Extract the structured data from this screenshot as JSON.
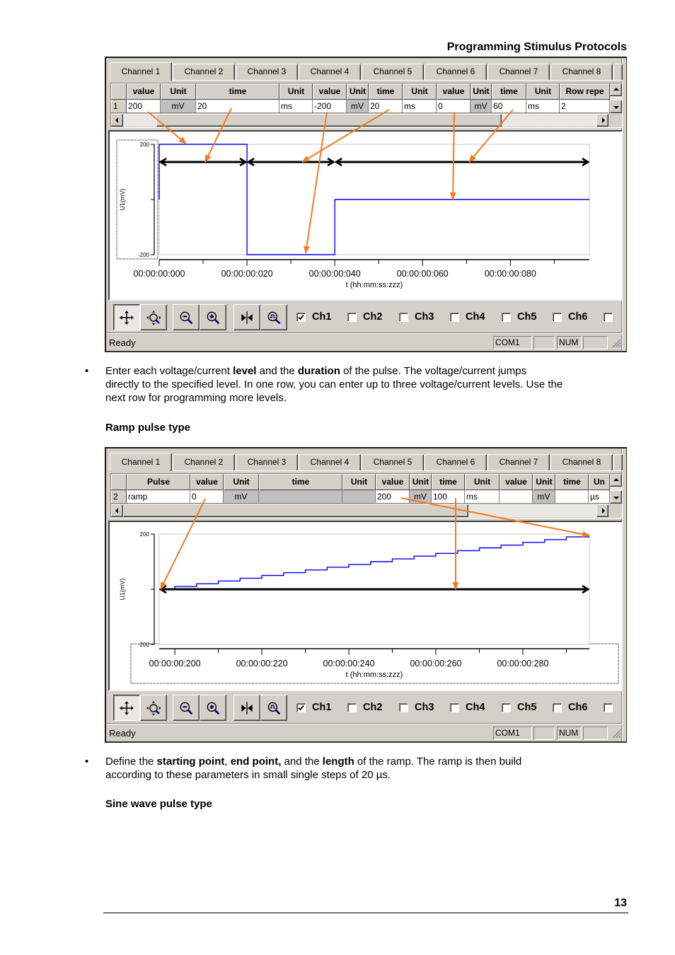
{
  "page": {
    "header_title": "Programming Stimulus Protocols",
    "page_number": "13",
    "bullet_glyph": "•"
  },
  "bullet1": {
    "line1": [
      "Enter each voltage/current ",
      "level",
      " and the ",
      "duration",
      " of the pulse. The voltage/current jumps"
    ],
    "line2": "directly to the specified level. In one row, you can enter up to three voltage/current levels. Use the",
    "line3": "next row for programming more levels."
  },
  "heading_ramp": "Ramp pulse type",
  "bullet2": {
    "line1": [
      "Define the ",
      "starting point",
      ", ",
      "end point,",
      " and the ",
      "length",
      " of the ramp. The ramp is then build"
    ],
    "line2": "according to these parameters in small single steps of 20 µs."
  },
  "heading_sine": "Sine wave pulse type",
  "colors": {
    "annotation": "#f47b20",
    "trace": "#0000ff",
    "window_bg": "#d4d0c8"
  },
  "windows": [
    {
      "tabs": [
        "Channel 1",
        "Channel 2",
        "Channel 3",
        "Channel 4",
        "Channel 5",
        "Channel 6",
        "Channel 7",
        "Channel 8"
      ],
      "active_tab": "Channel 1",
      "grid": {
        "columns": [
          "value",
          "Unit",
          "time",
          "Unit",
          "value",
          "Unit",
          "time",
          "Unit",
          "value",
          "Unit",
          "time",
          "Unit",
          "Row repe"
        ],
        "row": {
          "index": "1",
          "cells": [
            {
              "text": "200",
              "readonly": false
            },
            {
              "text": "mV",
              "readonly": true
            },
            {
              "text": "20",
              "readonly": false
            },
            {
              "text": "ms",
              "readonly": false
            },
            {
              "text": "-200",
              "readonly": false
            },
            {
              "text": "mV",
              "readonly": true
            },
            {
              "text": "20",
              "readonly": false
            },
            {
              "text": "ms",
              "readonly": false
            },
            {
              "text": "0",
              "readonly": false
            },
            {
              "text": "mV",
              "readonly": true
            },
            {
              "text": "60",
              "readonly": false
            },
            {
              "text": "ms",
              "readonly": false
            },
            {
              "text": "2",
              "readonly": false
            }
          ]
        },
        "h_scroll": {
          "position": 0.07,
          "visible_fraction": 0.73
        }
      },
      "toolbar": {
        "buttons": [
          {
            "id": "pan",
            "icon": "pan-icon",
            "pressed": true
          },
          {
            "id": "zoom-fit",
            "icon": "zoom-fit-icon",
            "pressed": false
          },
          {
            "id": "zoom-out",
            "icon": "zoom-out-icon",
            "pressed": false
          },
          {
            "id": "zoom-in",
            "icon": "zoom-in-icon",
            "pressed": false
          },
          {
            "id": "marker",
            "icon": "marker-icon",
            "pressed": false
          },
          {
            "id": "signal-zoom",
            "icon": "signal-zoom-icon",
            "pressed": false
          }
        ],
        "channels": [
          {
            "label": "Ch1",
            "checked": true
          },
          {
            "label": "Ch2",
            "checked": false
          },
          {
            "label": "Ch3",
            "checked": false
          },
          {
            "label": "Ch4",
            "checked": false
          },
          {
            "label": "Ch5",
            "checked": false
          },
          {
            "label": "Ch6",
            "checked": false
          },
          {
            "label": "",
            "checked": false
          }
        ]
      },
      "status": {
        "text": "Ready",
        "panels": [
          "COM1",
          "",
          "NUM",
          ""
        ]
      }
    },
    {
      "tabs": [
        "Channel 1",
        "Channel 2",
        "Channel 3",
        "Channel 4",
        "Channel 5",
        "Channel 6",
        "Channel 7",
        "Channel 8"
      ],
      "active_tab": "Channel 1",
      "grid": {
        "columns": [
          "Pulse",
          "value",
          "Unit",
          "time",
          "Unit",
          "value",
          "Unit",
          "time",
          "Unit",
          "value",
          "Unit",
          "time",
          "Un"
        ],
        "row": {
          "index": "2",
          "cells": [
            {
              "text": "ramp",
              "readonly": false
            },
            {
              "text": "0",
              "readonly": false
            },
            {
              "text": "mV",
              "readonly": true
            },
            {
              "text": "",
              "readonly": true
            },
            {
              "text": "",
              "readonly": true
            },
            {
              "text": "200",
              "readonly": false
            },
            {
              "text": "mV",
              "readonly": true
            },
            {
              "text": "100",
              "readonly": false
            },
            {
              "text": "ms",
              "readonly": false
            },
            {
              "text": "",
              "readonly": false
            },
            {
              "text": "mV",
              "readonly": true
            },
            {
              "text": "",
              "readonly": false
            },
            {
              "text": "µs",
              "readonly": false
            }
          ]
        },
        "h_scroll": {
          "position": 0.0,
          "visible_fraction": 0.73
        }
      },
      "toolbar": {
        "buttons": [
          {
            "id": "pan",
            "icon": "pan-icon",
            "pressed": true
          },
          {
            "id": "zoom-fit",
            "icon": "zoom-fit-icon",
            "pressed": false
          },
          {
            "id": "zoom-out",
            "icon": "zoom-out-icon",
            "pressed": false
          },
          {
            "id": "zoom-in",
            "icon": "zoom-in-icon",
            "pressed": false
          },
          {
            "id": "marker",
            "icon": "marker-icon",
            "pressed": false
          },
          {
            "id": "signal-zoom",
            "icon": "signal-zoom-icon",
            "pressed": false
          }
        ],
        "channels": [
          {
            "label": "Ch1",
            "checked": true
          },
          {
            "label": "Ch2",
            "checked": false
          },
          {
            "label": "Ch3",
            "checked": false
          },
          {
            "label": "Ch4",
            "checked": false
          },
          {
            "label": "Ch5",
            "checked": false
          },
          {
            "label": "Ch6",
            "checked": false
          },
          {
            "label": "",
            "checked": false
          }
        ]
      },
      "status": {
        "text": "Ready",
        "panels": [
          "COM1",
          "",
          "NUM",
          ""
        ]
      }
    }
  ],
  "chart_data": [
    {
      "type": "line",
      "title": "",
      "xlabel": "t (hh:mm:ss:zzz)",
      "ylabel": "U1(mV)",
      "xlim": [
        0,
        98
      ],
      "ylim": [
        -200,
        200
      ],
      "x_ticks": [
        0,
        20,
        40,
        60,
        80
      ],
      "x_tick_labels": [
        "00:00:00:000",
        "00:00:00:020",
        "00:00:00:040",
        "00:00:00:060",
        "00:00:00:080"
      ],
      "x_minor_ticks": [
        10,
        30,
        50,
        70,
        90
      ],
      "y_ticks": [
        200,
        0,
        -200
      ],
      "y_tick_labels": [
        "200",
        "",
        "-200"
      ],
      "grid": false,
      "legend": "none",
      "series": [
        {
          "name": "Ch1",
          "color": "#0000ff",
          "step": "post",
          "x": [
            0,
            0,
            20,
            40
          ],
          "y": [
            0,
            200,
            -200,
            0
          ]
        }
      ],
      "annotations": {
        "duration_markers": [
          [
            0,
            20
          ],
          [
            20,
            40
          ],
          [
            40,
            98
          ]
        ]
      }
    },
    {
      "type": "line",
      "title": "",
      "xlabel": "t (hh:mm:ss:zzz)",
      "ylabel": "U1(mV)",
      "xlim": [
        196.4,
        295.3
      ],
      "ylim": [
        -200,
        200
      ],
      "x_ticks": [
        200,
        220,
        240,
        260,
        280
      ],
      "x_tick_labels": [
        "00:00:00:200",
        "00:00:00:220",
        "00:00:00:240",
        "00:00:00:260",
        "00:00:00:280"
      ],
      "x_minor_ticks": [
        210,
        230,
        250,
        270,
        290
      ],
      "y_ticks": [
        200,
        0,
        -200
      ],
      "y_tick_labels": [
        "200",
        "",
        "-200"
      ],
      "grid": false,
      "legend": "none",
      "series": [
        {
          "name": "Ch1",
          "color": "#0000ff",
          "step": "post",
          "x": [
            196.4,
            200,
            205,
            210,
            215,
            220,
            225,
            230,
            235,
            240,
            245,
            250,
            255,
            260,
            265,
            270,
            275,
            280,
            285,
            290
          ],
          "y": [
            0,
            10,
            20,
            30,
            40,
            50,
            60,
            70,
            80,
            90,
            100,
            110,
            120,
            130,
            140,
            150,
            160,
            170,
            180,
            190
          ]
        }
      ],
      "annotations": {
        "duration_markers": [
          [
            196.4,
            295.3
          ]
        ]
      }
    }
  ]
}
